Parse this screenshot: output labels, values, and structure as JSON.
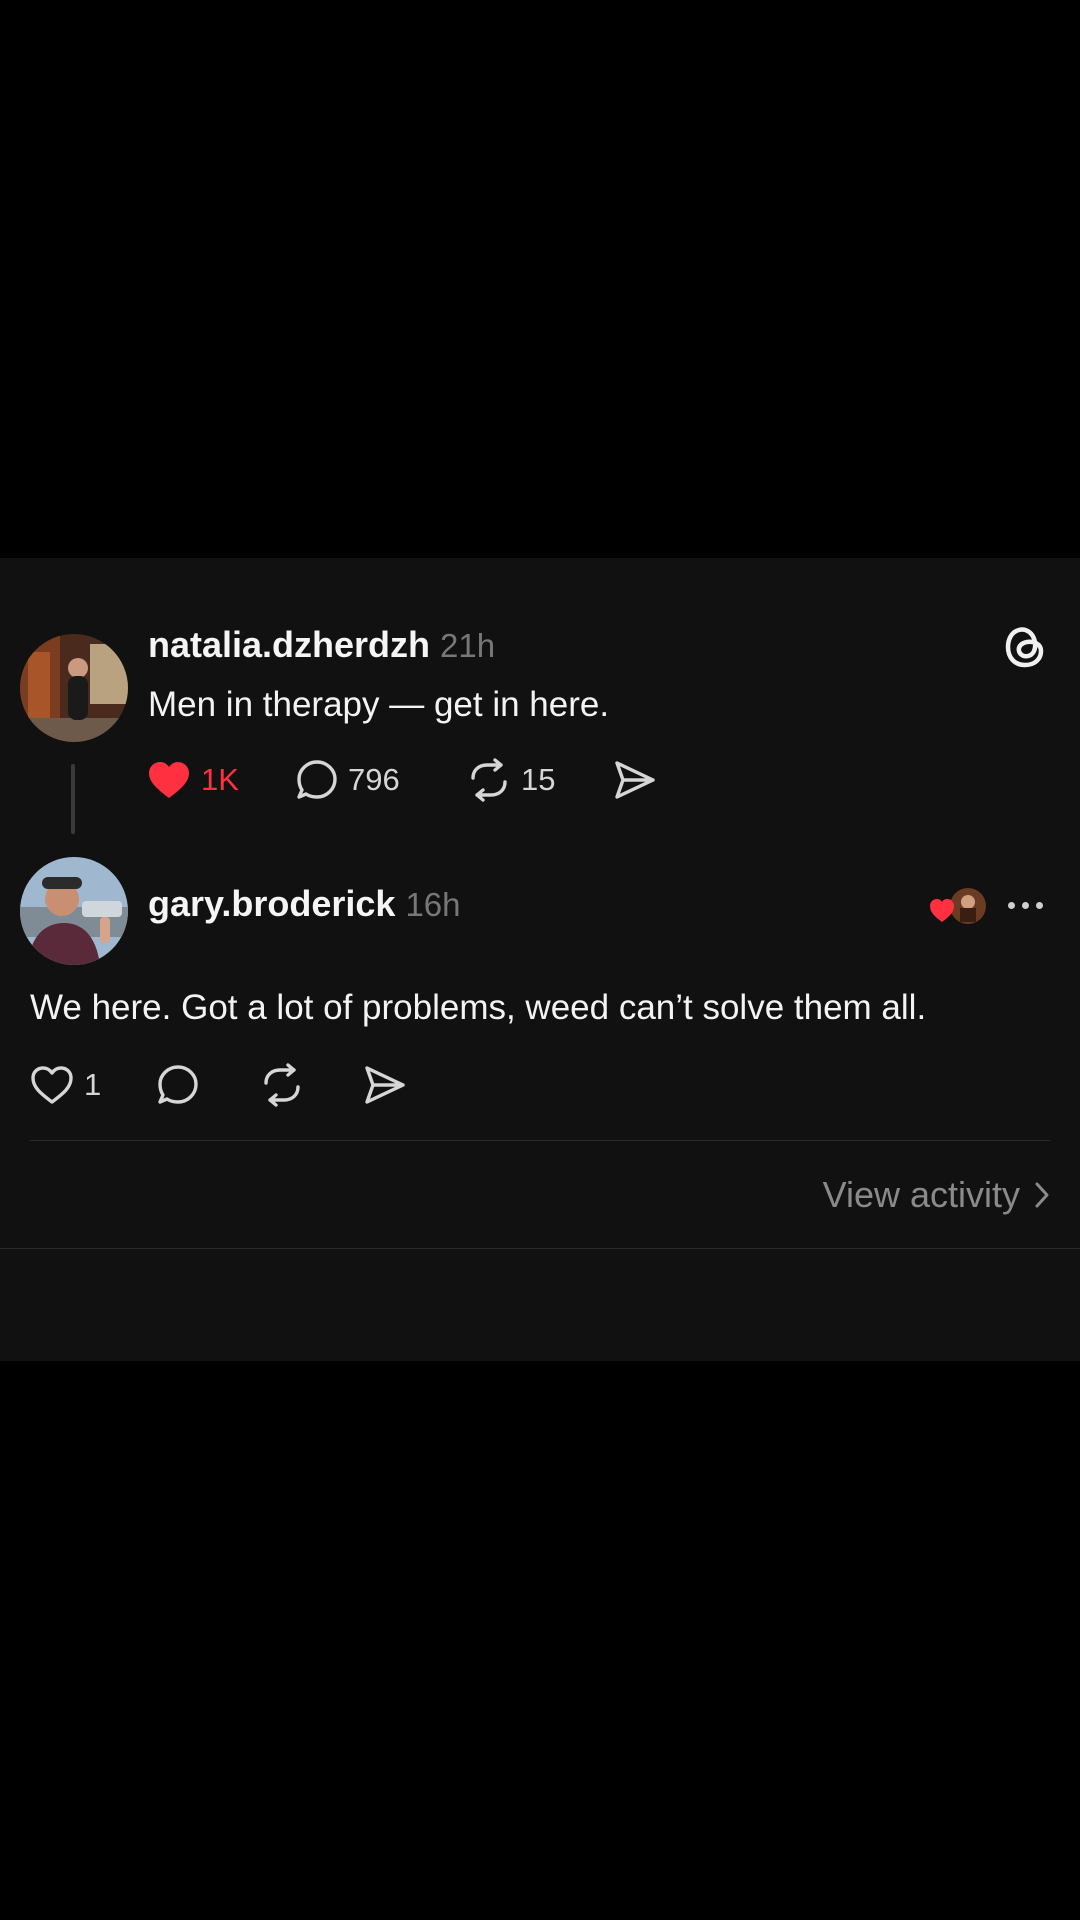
{
  "post": {
    "username": "natalia.dzherdzh",
    "time": "21h",
    "text": "Men in therapy — get in here.",
    "likes": "1K",
    "replies": "796",
    "reposts": "15",
    "liked": true
  },
  "reply": {
    "username": "gary.broderick",
    "time": "16h",
    "text": "We here. Got a lot of problems, weed can’t solve them all.",
    "likes": "1"
  },
  "footer": {
    "view_activity": "View activity"
  },
  "colors": {
    "like_red": "#ff3040",
    "card_bg": "#111111",
    "muted": "#777777"
  }
}
